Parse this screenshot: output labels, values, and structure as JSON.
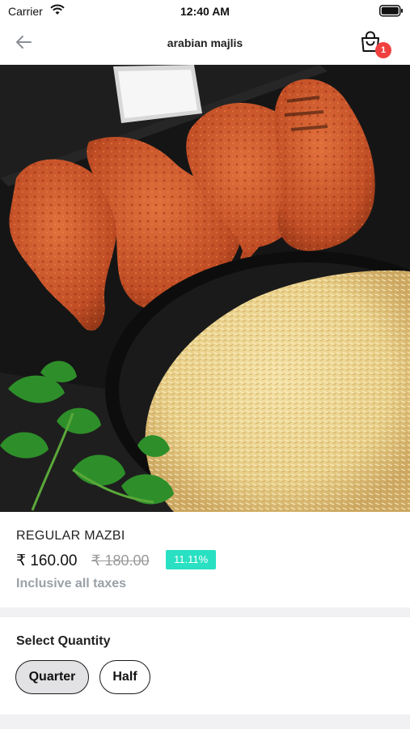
{
  "status_bar": {
    "carrier": "Carrier",
    "time": "12:40 AM"
  },
  "nav": {
    "title": "arabian majlis",
    "cart_count": "1"
  },
  "product": {
    "name": "REGULAR MAZBI",
    "price": "₹ 160.00",
    "original_price": "₹ 180.00",
    "discount": "11.11%",
    "tax_note": "Inclusive all taxes"
  },
  "quantity": {
    "title": "Select Quantity",
    "options": [
      {
        "label": "Quarter",
        "selected": true
      },
      {
        "label": "Half",
        "selected": false
      }
    ]
  },
  "colors": {
    "discount_badge": "#29e0c2",
    "cart_badge": "#f04040",
    "selected_option": "#e2e2e4"
  }
}
